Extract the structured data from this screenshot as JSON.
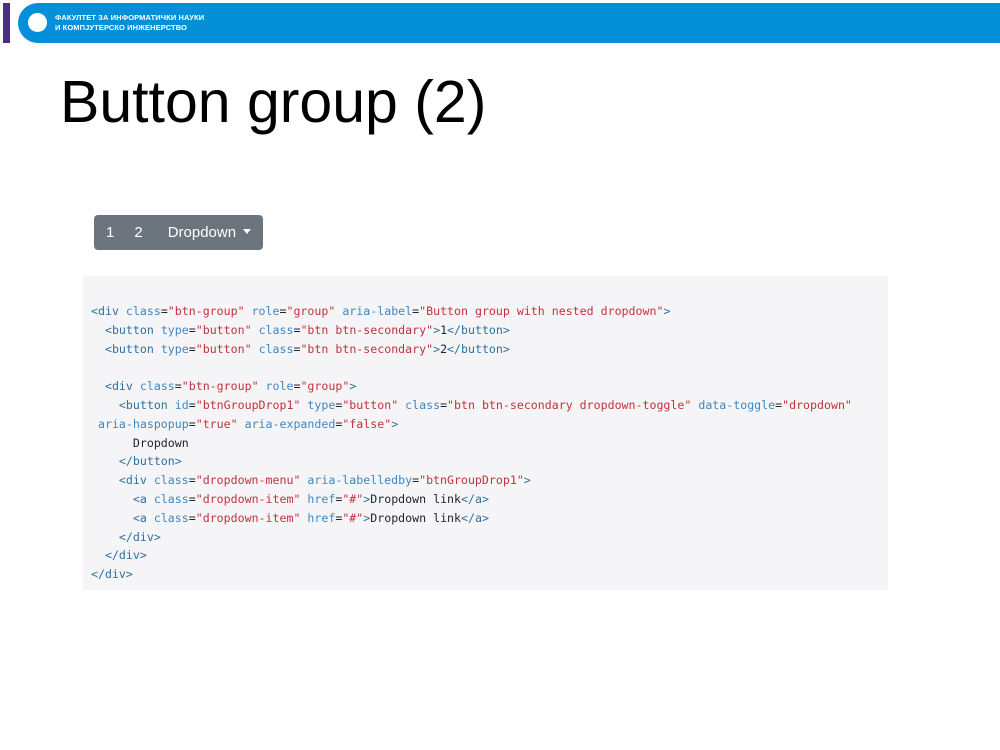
{
  "header": {
    "line1": "ФАКУЛТЕТ ЗА ИНФОРМАТИЧКИ НАУКИ",
    "line2": "И КОМПЈУТЕРСКО ИНЖЕНЕРСТВО",
    "accent_color": "#0490d8",
    "bar_color": "#4a2f86"
  },
  "slide": {
    "title": "Button group (2)"
  },
  "button_group": {
    "buttons": [
      "1",
      "2"
    ],
    "dropdown_label": "Dropdown",
    "color": "#6c757d"
  },
  "code": {
    "lines": [
      "<div class=\"btn-group\" role=\"group\" aria-label=\"Button group with nested dropdown\">",
      "  <button type=\"button\" class=\"btn btn-secondary\">1</button>",
      "  <button type=\"button\" class=\"btn btn-secondary\">2</button>",
      "",
      "  <div class=\"btn-group\" role=\"group\">",
      "    <button id=\"btnGroupDrop1\" type=\"button\" class=\"btn btn-secondary dropdown-toggle\" data-toggle=\"dropdown\"",
      " aria-haspopup=\"true\" aria-expanded=\"false\">",
      "      Dropdown",
      "    </button>",
      "    <div class=\"dropdown-menu\" aria-labelledby=\"btnGroupDrop1\">",
      "      <a class=\"dropdown-item\" href=\"#\">Dropdown link</a>",
      "      <a class=\"dropdown-item\" href=\"#\">Dropdown link</a>",
      "    </div>",
      "  </div>",
      "</div>"
    ]
  }
}
